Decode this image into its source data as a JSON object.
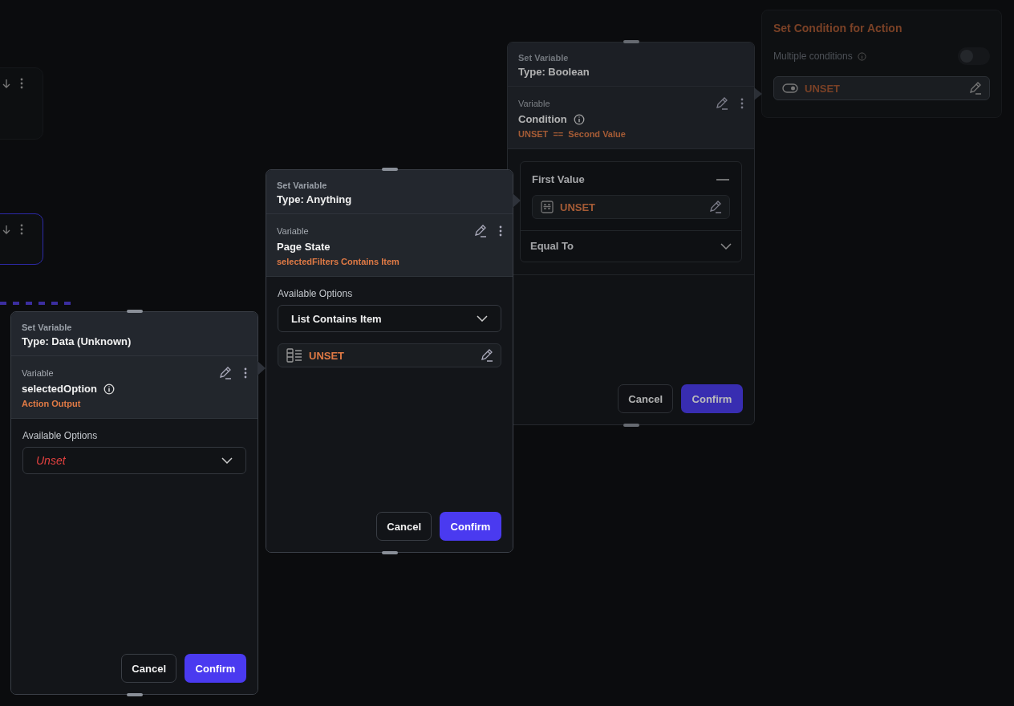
{
  "canvas_nodes": [
    {
      "selected": false
    },
    {
      "selected": true
    }
  ],
  "condition_panel": {
    "title": "Set Condition for Action",
    "toggle_label": "Multiple conditions",
    "toggle_on": false,
    "field": {
      "value": "UNSET"
    }
  },
  "panels": [
    {
      "dimmed": true,
      "subtitle": "Set Variable",
      "title": "Type: Boolean",
      "variable_label": "Variable",
      "variable_name": "Condition",
      "info": true,
      "source": "UNSET  ==  Second Value",
      "body": {
        "kind": "comparison",
        "sections": [
          {
            "title": "First Value",
            "expanded": true,
            "field": {
              "value": "UNSET"
            }
          },
          {
            "title": "Equal To",
            "expanded": false
          }
        ]
      },
      "buttons": [
        {
          "label": "Cancel",
          "kind": "secondary"
        },
        {
          "label": "Confirm",
          "kind": "primary"
        }
      ]
    },
    {
      "dimmed": false,
      "subtitle": "Set Variable",
      "title": "Type: Anything",
      "variable_label": "Variable",
      "variable_name": "Page State",
      "info": false,
      "source": "selectedFilters Contains Item",
      "body": {
        "kind": "options",
        "label": "Available Options",
        "dropdown": {
          "value": "List Contains Item",
          "empty": false
        },
        "field": {
          "value": "UNSET"
        }
      },
      "buttons": [
        {
          "label": "Cancel",
          "kind": "secondary"
        },
        {
          "label": "Confirm",
          "kind": "primary"
        }
      ]
    },
    {
      "dimmed": false,
      "subtitle": "Set Variable",
      "title": "Type: Data (Unknown)",
      "variable_label": "Variable",
      "variable_name": "selectedOption",
      "info": true,
      "source": "Action Output",
      "body": {
        "kind": "options",
        "label": "Available Options",
        "dropdown": {
          "value": "Unset",
          "empty": true
        }
      },
      "buttons": [
        {
          "label": "Cancel",
          "kind": "secondary"
        },
        {
          "label": "Confirm",
          "kind": "primary"
        }
      ]
    }
  ]
}
